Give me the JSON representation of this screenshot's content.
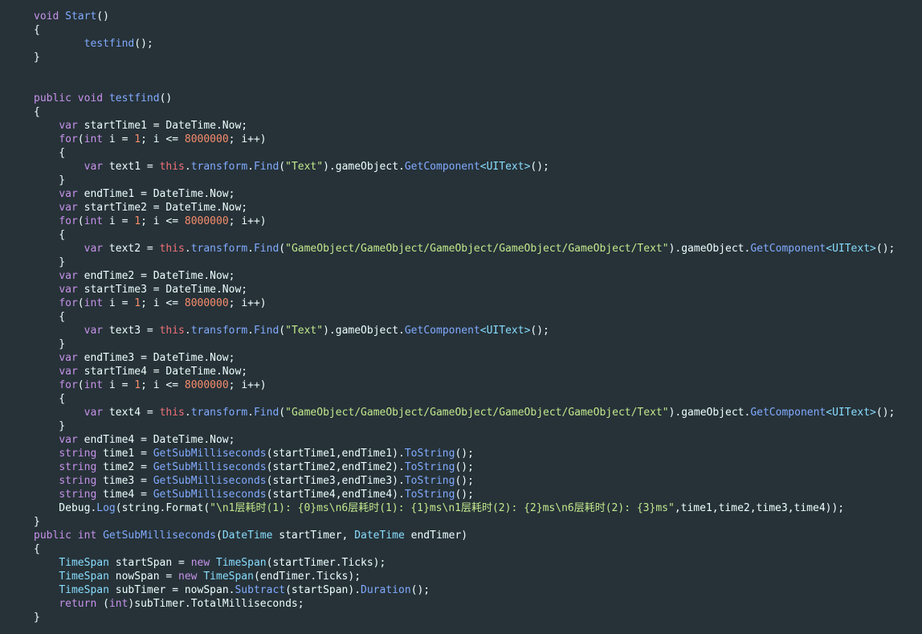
{
  "editor": {
    "palette": {
      "background": "#263238",
      "keyword": "#c792ea",
      "type": "#82aaff",
      "string": "#c3e88d",
      "number": "#f78c6c",
      "operator": "#89ddff",
      "this": "#f07178",
      "plain": "#eeffff"
    },
    "lines": [
      [
        [
          "kw",
          "void"
        ],
        [
          "pl",
          " "
        ],
        [
          "fn",
          "Start"
        ],
        [
          "pl",
          "()"
        ]
      ],
      [
        [
          "pl",
          "{"
        ]
      ],
      [
        [
          "pl",
          "        "
        ],
        [
          "fn",
          "testfind"
        ],
        [
          "pl",
          "();"
        ]
      ],
      [
        [
          "pl",
          "}"
        ]
      ],
      [
        [
          "pl",
          ""
        ]
      ],
      [
        [
          "pl",
          ""
        ]
      ],
      [
        [
          "kw",
          "public"
        ],
        [
          "pl",
          " "
        ],
        [
          "kw",
          "void"
        ],
        [
          "pl",
          " "
        ],
        [
          "fn",
          "testfind"
        ],
        [
          "pl",
          "()"
        ]
      ],
      [
        [
          "pl",
          "{"
        ]
      ],
      [
        [
          "pl",
          "    "
        ],
        [
          "kw",
          "var"
        ],
        [
          "pl",
          " startTime1 = DateTime.Now;"
        ]
      ],
      [
        [
          "pl",
          "    "
        ],
        [
          "kw",
          "for"
        ],
        [
          "pl",
          "("
        ],
        [
          "kw",
          "int"
        ],
        [
          "pl",
          " i = "
        ],
        [
          "num",
          "1"
        ],
        [
          "pl",
          "; i <= "
        ],
        [
          "num",
          "8000000"
        ],
        [
          "pl",
          "; i++)"
        ]
      ],
      [
        [
          "pl",
          "    {"
        ]
      ],
      [
        [
          "pl",
          "        "
        ],
        [
          "kw",
          "var"
        ],
        [
          "pl",
          " text1 = "
        ],
        [
          "this",
          "this"
        ],
        [
          "pl",
          "."
        ],
        [
          "fn",
          "transform"
        ],
        [
          "pl",
          "."
        ],
        [
          "fn",
          "Find"
        ],
        [
          "pl",
          "("
        ],
        [
          "str",
          "\"Text\""
        ],
        [
          "pl",
          ")."
        ],
        [
          "pl",
          "gameObject"
        ],
        [
          "pl",
          "."
        ],
        [
          "fn",
          "GetComponent"
        ],
        [
          "op",
          "<"
        ],
        [
          "ut",
          "UIText"
        ],
        [
          "op",
          ">"
        ],
        [
          "pl",
          "();"
        ]
      ],
      [
        [
          "pl",
          "    }"
        ]
      ],
      [
        [
          "pl",
          "    "
        ],
        [
          "kw",
          "var"
        ],
        [
          "pl",
          " endTime1 = DateTime.Now;"
        ]
      ],
      [
        [
          "pl",
          "    "
        ],
        [
          "kw",
          "var"
        ],
        [
          "pl",
          " startTime2 = DateTime.Now;"
        ]
      ],
      [
        [
          "pl",
          "    "
        ],
        [
          "kw",
          "for"
        ],
        [
          "pl",
          "("
        ],
        [
          "kw",
          "int"
        ],
        [
          "pl",
          " i = "
        ],
        [
          "num",
          "1"
        ],
        [
          "pl",
          "; i <= "
        ],
        [
          "num",
          "8000000"
        ],
        [
          "pl",
          "; i++)"
        ]
      ],
      [
        [
          "pl",
          "    {"
        ]
      ],
      [
        [
          "pl",
          "        "
        ],
        [
          "kw",
          "var"
        ],
        [
          "pl",
          " text2 = "
        ],
        [
          "this",
          "this"
        ],
        [
          "pl",
          "."
        ],
        [
          "fn",
          "transform"
        ],
        [
          "pl",
          "."
        ],
        [
          "fn",
          "Find"
        ],
        [
          "pl",
          "("
        ],
        [
          "str",
          "\"GameObject/GameObject/GameObject/GameObject/GameObject/Text\""
        ],
        [
          "pl",
          ")."
        ],
        [
          "pl",
          "gameObject"
        ],
        [
          "pl",
          "."
        ],
        [
          "fn",
          "GetComponent"
        ],
        [
          "op",
          "<"
        ],
        [
          "ut",
          "UIText"
        ],
        [
          "op",
          ">"
        ],
        [
          "pl",
          "();"
        ]
      ],
      [
        [
          "pl",
          "    }"
        ]
      ],
      [
        [
          "pl",
          "    "
        ],
        [
          "kw",
          "var"
        ],
        [
          "pl",
          " endTime2 = DateTime.Now;"
        ]
      ],
      [
        [
          "pl",
          "    "
        ],
        [
          "kw",
          "var"
        ],
        [
          "pl",
          " startTime3 = DateTime.Now;"
        ]
      ],
      [
        [
          "pl",
          "    "
        ],
        [
          "kw",
          "for"
        ],
        [
          "pl",
          "("
        ],
        [
          "kw",
          "int"
        ],
        [
          "pl",
          " i = "
        ],
        [
          "num",
          "1"
        ],
        [
          "pl",
          "; i <= "
        ],
        [
          "num",
          "8000000"
        ],
        [
          "pl",
          "; i++)"
        ]
      ],
      [
        [
          "pl",
          "    {"
        ]
      ],
      [
        [
          "pl",
          "        "
        ],
        [
          "kw",
          "var"
        ],
        [
          "pl",
          " text3 = "
        ],
        [
          "this",
          "this"
        ],
        [
          "pl",
          "."
        ],
        [
          "fn",
          "transform"
        ],
        [
          "pl",
          "."
        ],
        [
          "fn",
          "Find"
        ],
        [
          "pl",
          "("
        ],
        [
          "str",
          "\"Text\""
        ],
        [
          "pl",
          ")."
        ],
        [
          "pl",
          "gameObject"
        ],
        [
          "pl",
          "."
        ],
        [
          "fn",
          "GetComponent"
        ],
        [
          "op",
          "<"
        ],
        [
          "ut",
          "UIText"
        ],
        [
          "op",
          ">"
        ],
        [
          "pl",
          "();"
        ]
      ],
      [
        [
          "pl",
          "    }"
        ]
      ],
      [
        [
          "pl",
          "    "
        ],
        [
          "kw",
          "var"
        ],
        [
          "pl",
          " endTime3 = DateTime.Now;"
        ]
      ],
      [
        [
          "pl",
          "    "
        ],
        [
          "kw",
          "var"
        ],
        [
          "pl",
          " startTime4 = DateTime.Now;"
        ]
      ],
      [
        [
          "pl",
          "    "
        ],
        [
          "kw",
          "for"
        ],
        [
          "pl",
          "("
        ],
        [
          "kw",
          "int"
        ],
        [
          "pl",
          " i = "
        ],
        [
          "num",
          "1"
        ],
        [
          "pl",
          "; i <= "
        ],
        [
          "num",
          "8000000"
        ],
        [
          "pl",
          "; i++)"
        ]
      ],
      [
        [
          "pl",
          "    {"
        ]
      ],
      [
        [
          "pl",
          "        "
        ],
        [
          "kw",
          "var"
        ],
        [
          "pl",
          " text4 = "
        ],
        [
          "this",
          "this"
        ],
        [
          "pl",
          "."
        ],
        [
          "fn",
          "transform"
        ],
        [
          "pl",
          "."
        ],
        [
          "fn",
          "Find"
        ],
        [
          "pl",
          "("
        ],
        [
          "str",
          "\"GameObject/GameObject/GameObject/GameObject/GameObject/Text\""
        ],
        [
          "pl",
          ")."
        ],
        [
          "pl",
          "gameObject"
        ],
        [
          "pl",
          "."
        ],
        [
          "fn",
          "GetComponent"
        ],
        [
          "op",
          "<"
        ],
        [
          "ut",
          "UIText"
        ],
        [
          "op",
          ">"
        ],
        [
          "pl",
          "();"
        ]
      ],
      [
        [
          "pl",
          "    }"
        ]
      ],
      [
        [
          "pl",
          "    "
        ],
        [
          "kw",
          "var"
        ],
        [
          "pl",
          " endTime4 = DateTime.Now;"
        ]
      ],
      [
        [
          "pl",
          "    "
        ],
        [
          "kw",
          "string"
        ],
        [
          "pl",
          " time1 = "
        ],
        [
          "fn",
          "GetSubMilliseconds"
        ],
        [
          "pl",
          "(startTime1,endTime1)."
        ],
        [
          "fn",
          "ToString"
        ],
        [
          "pl",
          "();"
        ]
      ],
      [
        [
          "pl",
          "    "
        ],
        [
          "kw",
          "string"
        ],
        [
          "pl",
          " time2 = "
        ],
        [
          "fn",
          "GetSubMilliseconds"
        ],
        [
          "pl",
          "(startTime2,endTime2)."
        ],
        [
          "fn",
          "ToString"
        ],
        [
          "pl",
          "();"
        ]
      ],
      [
        [
          "pl",
          "    "
        ],
        [
          "kw",
          "string"
        ],
        [
          "pl",
          " time3 = "
        ],
        [
          "fn",
          "GetSubMilliseconds"
        ],
        [
          "pl",
          "(startTime3,endTime3)."
        ],
        [
          "fn",
          "ToString"
        ],
        [
          "pl",
          "();"
        ]
      ],
      [
        [
          "pl",
          "    "
        ],
        [
          "kw",
          "string"
        ],
        [
          "pl",
          " time4 = "
        ],
        [
          "fn",
          "GetSubMilliseconds"
        ],
        [
          "pl",
          "(startTime4,endTime4)."
        ],
        [
          "fn",
          "ToString"
        ],
        [
          "pl",
          "();"
        ]
      ],
      [
        [
          "pl",
          "    Debug."
        ],
        [
          "fn",
          "Log"
        ],
        [
          "pl",
          "(string.Format("
        ],
        [
          "str",
          "\"\\n1层耗时(1): {0}ms\\n6层耗时(1): {1}ms\\n1层耗时(2): {2}ms\\n6层耗时(2): {3}ms\""
        ],
        [
          "pl",
          ",time1,time2,time3,time4));"
        ]
      ],
      [
        [
          "pl",
          "}"
        ]
      ],
      [
        [
          "kw",
          "public"
        ],
        [
          "pl",
          " "
        ],
        [
          "kw",
          "int"
        ],
        [
          "pl",
          " "
        ],
        [
          "fn",
          "GetSubMilliseconds"
        ],
        [
          "pl",
          "("
        ],
        [
          "ut",
          "DateTime"
        ],
        [
          "pl",
          " startTimer, "
        ],
        [
          "ut",
          "DateTime"
        ],
        [
          "pl",
          " endTimer)"
        ]
      ],
      [
        [
          "pl",
          "{"
        ]
      ],
      [
        [
          "pl",
          "    "
        ],
        [
          "ut",
          "TimeSpan"
        ],
        [
          "pl",
          " startSpan = "
        ],
        [
          "kw",
          "new"
        ],
        [
          "pl",
          " "
        ],
        [
          "ut",
          "TimeSpan"
        ],
        [
          "pl",
          "(startTimer.Ticks);"
        ]
      ],
      [
        [
          "pl",
          "    "
        ],
        [
          "ut",
          "TimeSpan"
        ],
        [
          "pl",
          " nowSpan = "
        ],
        [
          "kw",
          "new"
        ],
        [
          "pl",
          " "
        ],
        [
          "ut",
          "TimeSpan"
        ],
        [
          "pl",
          "(endTimer.Ticks);"
        ]
      ],
      [
        [
          "pl",
          "    "
        ],
        [
          "ut",
          "TimeSpan"
        ],
        [
          "pl",
          " subTimer = nowSpan."
        ],
        [
          "fn",
          "Subtract"
        ],
        [
          "pl",
          "(startSpan)."
        ],
        [
          "fn",
          "Duration"
        ],
        [
          "pl",
          "();"
        ]
      ],
      [
        [
          "pl",
          "    "
        ],
        [
          "kw",
          "return"
        ],
        [
          "pl",
          " ("
        ],
        [
          "kw",
          "int"
        ],
        [
          "pl",
          ")subTimer.TotalMilliseconds;"
        ]
      ],
      [
        [
          "pl",
          "}"
        ]
      ]
    ]
  }
}
